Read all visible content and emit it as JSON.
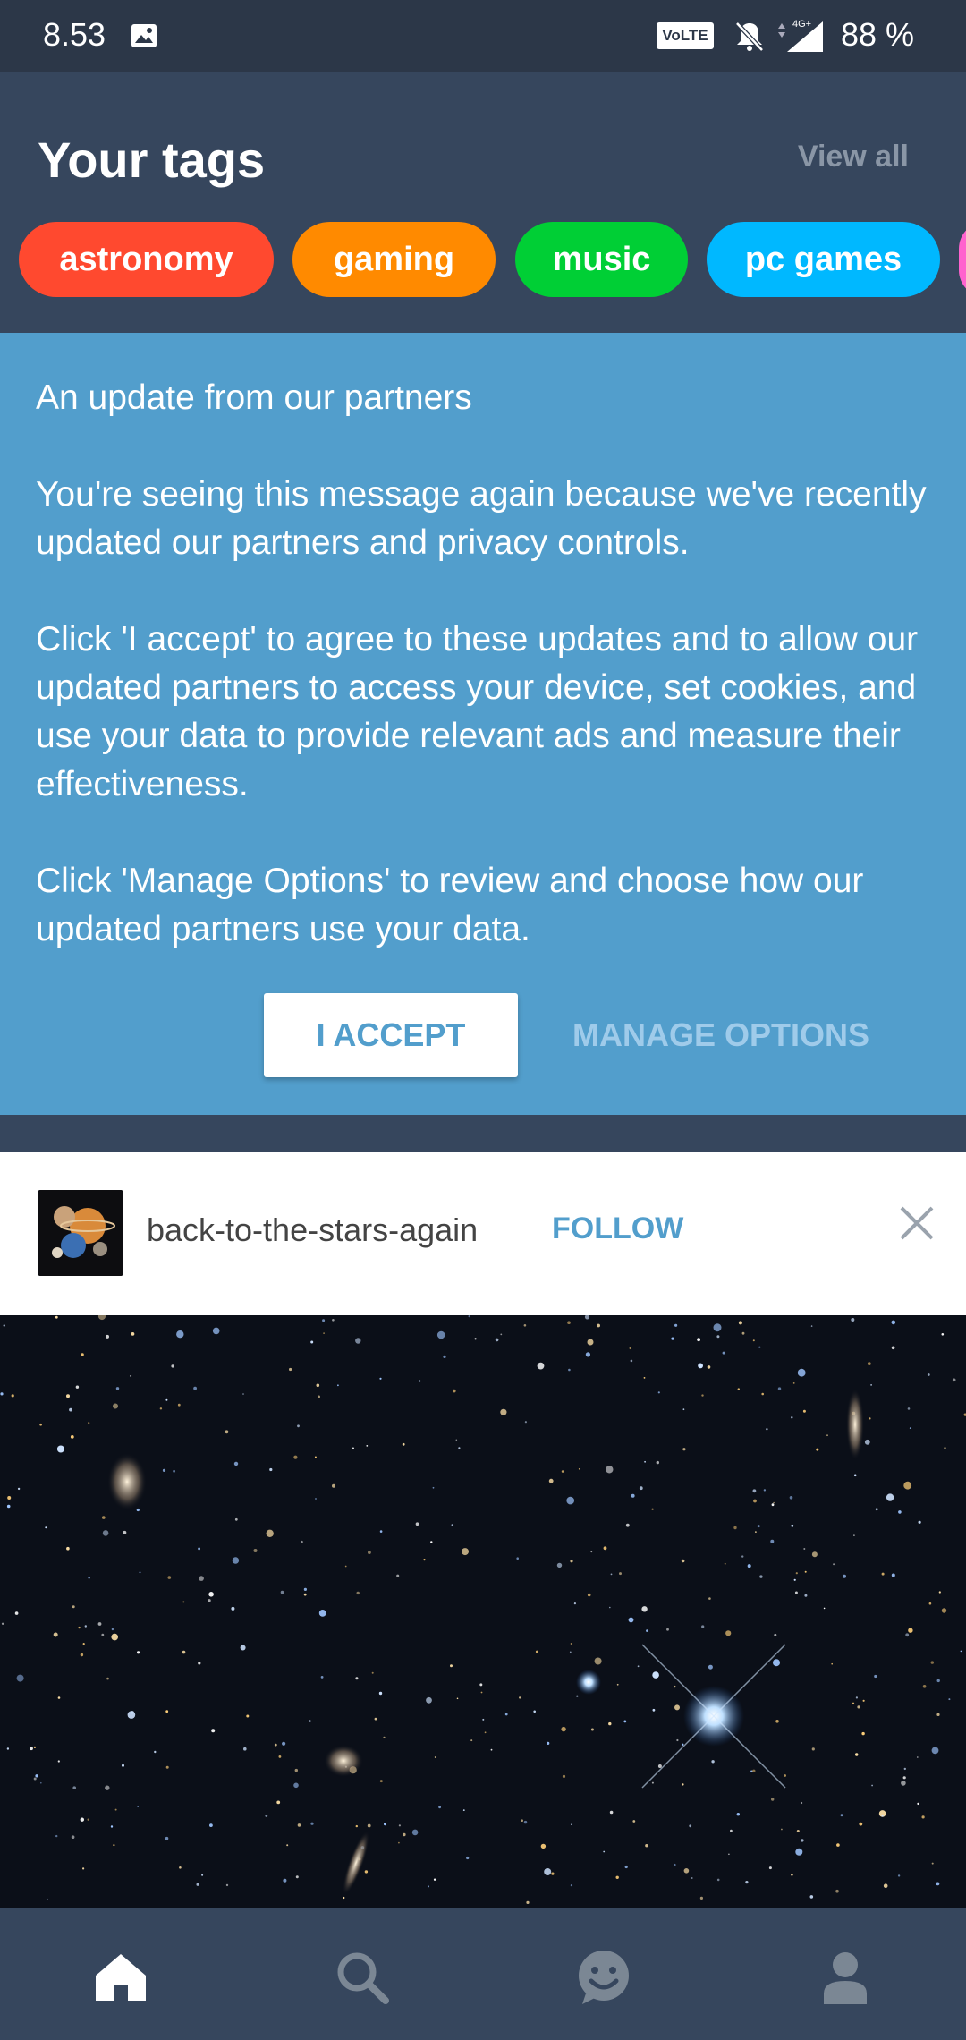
{
  "status_bar": {
    "time": "8.53",
    "volte": "VoLTE",
    "network": "4G+",
    "battery": "88 %"
  },
  "tags": {
    "title": "Your tags",
    "view_all": "View all",
    "items": [
      {
        "label": "astronomy",
        "color": "#ff492f"
      },
      {
        "label": "gaming",
        "color": "#ff8a00"
      },
      {
        "label": "music",
        "color": "#00cf35"
      },
      {
        "label": "pc games",
        "color": "#00b8ff"
      },
      {
        "label": "",
        "color": "#ff62ce"
      }
    ]
  },
  "consent": {
    "heading": "An update from our partners",
    "para1": "You're seeing this message again because we've recently updated our partners and privacy controls.",
    "para2": "Click 'I accept' to agree to these updates and to allow our updated partners to access your device, set cookies, and use your data to provide relevant ads and measure their effectiveness.",
    "para3": "Click 'Manage Options' to review and choose how our updated partners use your data.",
    "accept_label": "I ACCEPT",
    "manage_label": "MANAGE OPTIONS",
    "background": "#529ecc"
  },
  "post": {
    "blog_name": "back-to-the-stars-again",
    "follow_label": "FOLLOW",
    "avatar_icon": "planets-avatar",
    "close_icon": "close-icon"
  },
  "bottom_nav": [
    {
      "name": "home",
      "icon": "home-icon",
      "active": true
    },
    {
      "name": "search",
      "icon": "search-icon",
      "active": false
    },
    {
      "name": "activity",
      "icon": "smiley-icon",
      "active": false
    },
    {
      "name": "account",
      "icon": "person-icon",
      "active": false
    }
  ],
  "colors": {
    "app_bg": "#36465d",
    "accent": "#529ecc",
    "status_bar": "#2c3748"
  }
}
